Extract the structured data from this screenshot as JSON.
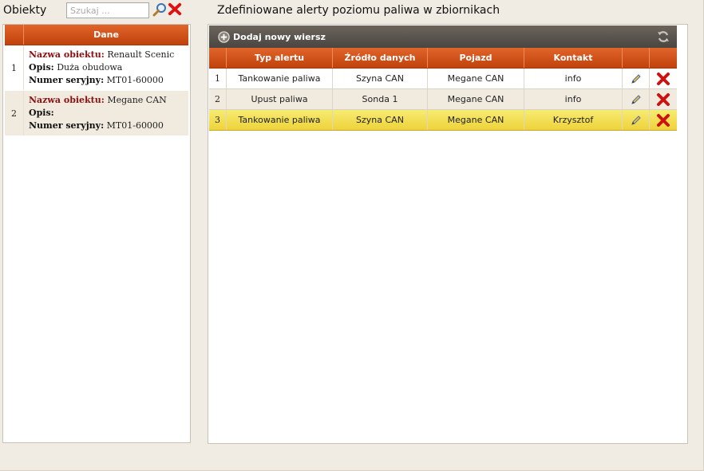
{
  "left": {
    "title": "Obiekty",
    "search_placeholder": "Szukaj ...",
    "column_header": "Dane",
    "items": [
      {
        "num": "1",
        "name_label": "Nazwa obiektu:",
        "name": "Renault Scenic",
        "desc_label": "Opis:",
        "desc": "Duża obudowa",
        "serial_label": "Numer seryjny:",
        "serial": "MT01-60000"
      },
      {
        "num": "2",
        "name_label": "Nazwa obiektu:",
        "name": "Megane CAN",
        "desc_label": "Opis:",
        "desc": "",
        "serial_label": "Numer seryjny:",
        "serial": "MT01-60000"
      }
    ]
  },
  "right": {
    "title": "Zdefiniowane alerty poziomu paliwa w zbiornikach",
    "add_row_label": "Dodaj nowy wiersz",
    "columns": [
      "Typ alertu",
      "Źródło danych",
      "Pojazd",
      "Kontakt"
    ],
    "rows": [
      {
        "num": "1",
        "type": "Tankowanie paliwa",
        "source": "Szyna CAN",
        "vehicle": "Megane CAN",
        "contact": "info"
      },
      {
        "num": "2",
        "type": "Upust paliwa",
        "source": "Sonda 1",
        "vehicle": "Megane CAN",
        "contact": "info"
      },
      {
        "num": "3",
        "type": "Tankowanie paliwa",
        "source": "Szyna CAN",
        "vehicle": "Megane CAN",
        "contact": "Krzysztof"
      }
    ],
    "selected_row": 3
  },
  "colors": {
    "header_orange": "#d0541a",
    "toolbar_dark": "#5a554e",
    "selected_yellow": "#f2dc4a",
    "delete_red": "#cc1111"
  }
}
